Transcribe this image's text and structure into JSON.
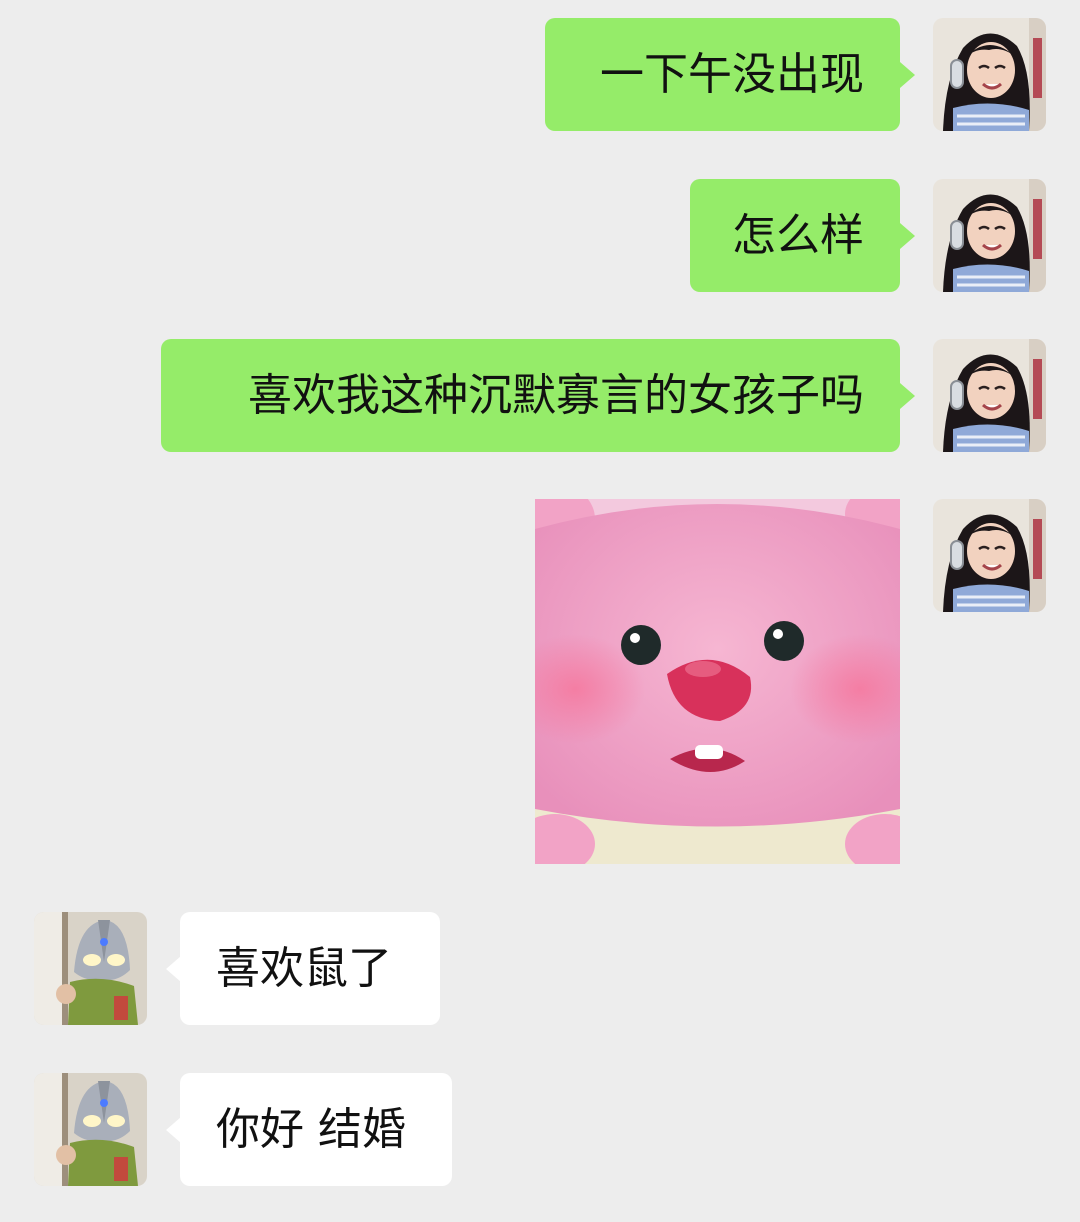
{
  "chat": {
    "messages": [
      {
        "sender": "me",
        "type": "text",
        "text": "一下午没出现"
      },
      {
        "sender": "me",
        "type": "text",
        "text": "怎么样"
      },
      {
        "sender": "me",
        "type": "text",
        "text": "喜欢我这种沉默寡言的女孩子吗"
      },
      {
        "sender": "me",
        "type": "sticker",
        "sticker": "pink-beaver-sticker"
      },
      {
        "sender": "them",
        "type": "text",
        "text": "喜欢鼠了"
      },
      {
        "sender": "them",
        "type": "text",
        "text": "你好 结婚"
      }
    ]
  },
  "colors": {
    "background": "#ededed",
    "my_bubble": "#95ec69",
    "their_bubble": "#ffffff",
    "text": "#111111"
  },
  "icons": {
    "my_avatar": "girl-with-headphones-avatar",
    "their_avatar": "ultraman-mask-avatar"
  }
}
